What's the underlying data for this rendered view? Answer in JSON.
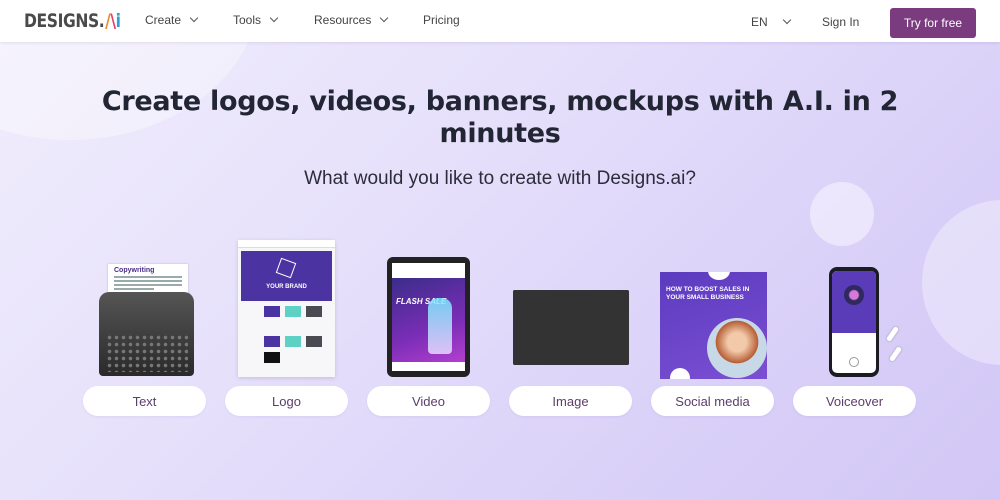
{
  "header": {
    "logo_text": "DESIGNS.",
    "logo_ai": "AI",
    "nav": [
      {
        "label": "Create",
        "has_dropdown": true
      },
      {
        "label": "Tools",
        "has_dropdown": true
      },
      {
        "label": "Resources",
        "has_dropdown": true
      },
      {
        "label": "Pricing",
        "has_dropdown": false
      }
    ],
    "language": "EN",
    "sign_in": "Sign In",
    "cta": "Try for free",
    "cta_color": "#7b3b7f"
  },
  "hero": {
    "title": "Create logos, videos, banners, mockups with A.I. in 2 minutes",
    "subtitle": "What would you like to create with Designs.ai?"
  },
  "cards": [
    {
      "label": "Text",
      "preview_title": "Copywriting"
    },
    {
      "label": "Logo",
      "preview_title": "YOUR BRAND"
    },
    {
      "label": "Video",
      "preview_title": "FLASH SALE"
    },
    {
      "label": "Image"
    },
    {
      "label": "Social media",
      "preview_title": "HOW TO BOOST SALES IN YOUR SMALL BUSINESS"
    },
    {
      "label": "Voiceover"
    }
  ]
}
